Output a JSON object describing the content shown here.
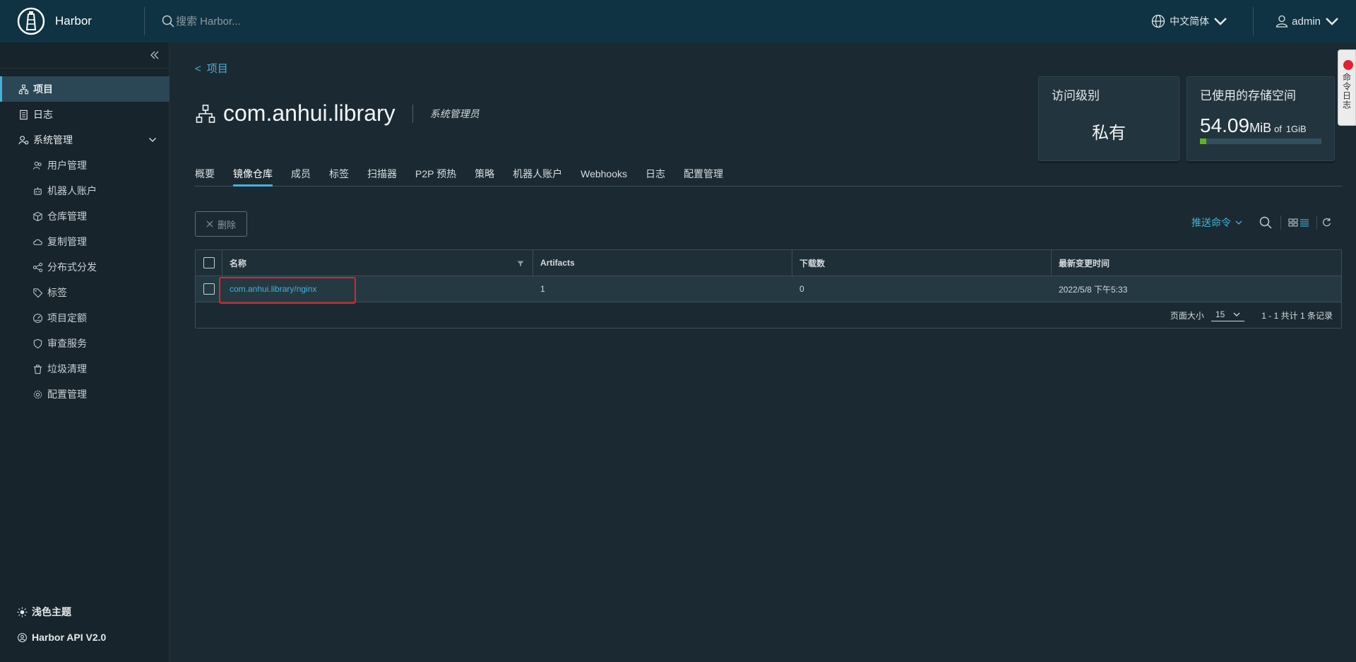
{
  "header": {
    "brand_name": "Harbor",
    "search_placeholder": "搜索 Harbor...",
    "language": "中文简体",
    "user": "admin"
  },
  "sidebar": {
    "items": [
      {
        "label": "项目",
        "icon": "project-icon",
        "active": true
      },
      {
        "label": "日志",
        "icon": "log-icon"
      },
      {
        "label": "系统管理",
        "icon": "admin-icon",
        "expandable": true
      }
    ],
    "sub_items": [
      {
        "label": "用户管理",
        "icon": "users-icon"
      },
      {
        "label": "机器人账户",
        "icon": "robot-icon"
      },
      {
        "label": "仓库管理",
        "icon": "registry-icon"
      },
      {
        "label": "复制管理",
        "icon": "replication-icon"
      },
      {
        "label": "分布式分发",
        "icon": "distribution-icon"
      },
      {
        "label": "标签",
        "icon": "tag-icon"
      },
      {
        "label": "项目定额",
        "icon": "quota-icon"
      },
      {
        "label": "审查服务",
        "icon": "shield-icon"
      },
      {
        "label": "垃圾清理",
        "icon": "trash-icon"
      },
      {
        "label": "配置管理",
        "icon": "gear-icon"
      }
    ],
    "bottom": [
      {
        "label": "浅色主题",
        "icon": "sun-icon"
      },
      {
        "label": "Harbor API V2.0",
        "icon": "api-icon"
      }
    ]
  },
  "main": {
    "back_label": "项目",
    "project_name": "com.anhui.library",
    "role": "系统管理员",
    "access_card": {
      "label": "访问级别",
      "value": "私有"
    },
    "storage_card": {
      "label": "已使用的存储空间",
      "used": "54.09",
      "used_unit": "MiB",
      "of_label": "of",
      "total": "1GiB",
      "used_fraction": 0.053
    },
    "tabs": [
      "概要",
      "镜像仓库",
      "成员",
      "标签",
      "扫描器",
      "P2P 预热",
      "策略",
      "机器人账户",
      "Webhooks",
      "日志",
      "配置管理"
    ],
    "active_tab": "镜像仓库",
    "delete_label": "删除",
    "push_command_label": "推送命令",
    "grid": {
      "columns": [
        "名称",
        "Artifacts",
        "下载数",
        "最新变更时间"
      ],
      "rows": [
        {
          "name": "com.anhui.library/nginx",
          "artifacts": "1",
          "downloads": "0",
          "updated": "2022/5/8 下午5:33"
        }
      ],
      "page_size_label": "页面大小",
      "page_size": "15",
      "summary": "1 - 1 共计 1 条记录"
    }
  },
  "floating_tab": {
    "label": "命令日志"
  },
  "colors": {
    "header_bg": "#0f3342",
    "accent": "#49afd9",
    "highlight_box": "#e0232e",
    "storage_bar": "#60b515"
  }
}
